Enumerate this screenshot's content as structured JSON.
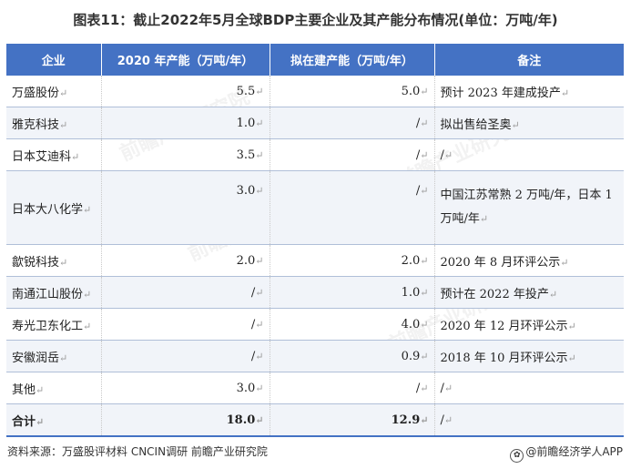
{
  "title": "图表11：截止2022年5月全球BDP主要企业及其产能分布情况(单位：万吨/年)",
  "table": {
    "headers": [
      "企业",
      "2020 年产能（万吨/年）",
      "拟在建产能（万吨/年）",
      "备注"
    ],
    "rows": [
      {
        "company": "万盛股份",
        "cap2020": "5.5",
        "planned": "5.0",
        "note": "预计 2023 年建成投产"
      },
      {
        "company": "雅克科技",
        "cap2020": "1.0",
        "planned": "/",
        "note": "拟出售给圣奥"
      },
      {
        "company": "日本艾迪科",
        "cap2020": "3.5",
        "planned": "/",
        "note": "/"
      },
      {
        "company": "日本大八化学",
        "cap2020": "3.0",
        "planned": "/",
        "note": "中国江苏常熟 2 万吨/年，日本 1 万吨/年"
      },
      {
        "company": "歙锐科技",
        "cap2020": "2.0",
        "planned": "2.0",
        "note": "2020 年 8 月环评公示"
      },
      {
        "company": "南通江山股份",
        "cap2020": "/",
        "planned": "1.0",
        "note": "预计在 2022 年投产"
      },
      {
        "company": "寿光卫东化工",
        "cap2020": "/",
        "planned": "4.0",
        "note": "2020 年 12 月环评公示"
      },
      {
        "company": "安徽润岳",
        "cap2020": "/",
        "planned": "0.9",
        "note": "2018 年 10 月环评公示"
      },
      {
        "company": "其他",
        "cap2020": "3.0",
        "planned": "/",
        "note": "/"
      }
    ],
    "total": {
      "company": "合计",
      "cap2020": "18.0",
      "planned": "12.9",
      "note": "/"
    }
  },
  "source": "资料来源：万盛股评材料 CNCIN调研 前瞻产业研究院",
  "brand": "@前瞻经济学人APP",
  "brand_icon": "leaf-logo-icon",
  "watermark": "前瞻产业研究院",
  "paragraph_mark": "↵",
  "colors": {
    "header_bg": "#4472c4",
    "header_text": "#ffffff",
    "alt_row": "#f1f4f9"
  }
}
